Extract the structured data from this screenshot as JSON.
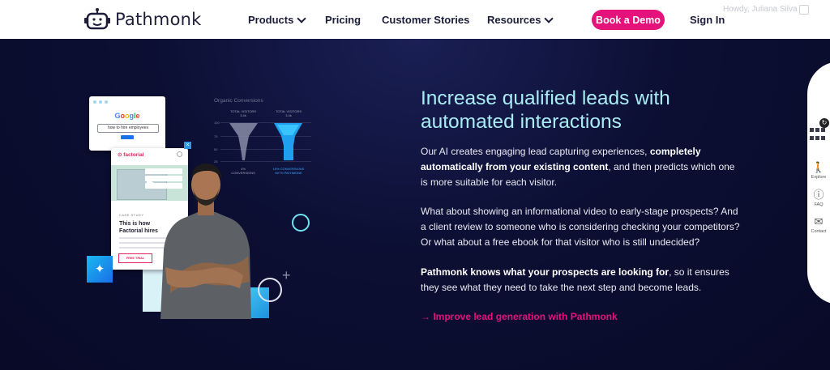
{
  "header": {
    "logo_text": "Pathmonk",
    "nav": [
      {
        "label": "Products",
        "has_dropdown": true
      },
      {
        "label": "Pricing",
        "has_dropdown": false
      },
      {
        "label": "Customer Stories",
        "has_dropdown": false
      },
      {
        "label": "Resources",
        "has_dropdown": true
      }
    ],
    "demo_button": "Book a Demo",
    "sign_in": "Sign In",
    "howdy": "Howdy, Juliana Silva"
  },
  "hero": {
    "headline": "Increase qualified leads with automated interactions",
    "p1_a": "Our AI creates engaging lead capturing experiences, ",
    "p1_b": "completely automatically from your existing content",
    "p1_c": ", and then predicts which one is more suitable for each visitor.",
    "p2": "What about showing an informational video to early-stage prospects? And a client review to someone who is considering checking your competitors? Or what about a free ebook for that visitor who is still undecided?",
    "p3_a": "Pathmonk knows what your prospects are looking for",
    "p3_b": ", so it ensures they see what they need to take the next step and become leads.",
    "cta": "→ Improve lead generation with Pathmonk"
  },
  "illustration": {
    "google_logo": "Google",
    "google_query": "how to hire employees",
    "factorial_logo": "factorial",
    "case_label": "CASE STUDY",
    "case_title": "This is how Factorial hires",
    "free_trial": "FREE TRIAL",
    "close": "×",
    "funnel_title": "Organic Conversions",
    "funnel_hdr_left": "TOTAL VISITORS 3.4k",
    "funnel_hdr_right": "TOTAL VISITORS 3.4k",
    "funnel_rows": [
      "100",
      "75",
      "50",
      "25",
      "0"
    ],
    "funnel_caption_left": "4% CONVERSIONS",
    "funnel_caption_right": "15% CONVERSIONS WITH PATHMONK",
    "sparkle": "✦"
  },
  "sidebar": {
    "badge": "↻",
    "items": [
      {
        "icon": "explore-icon",
        "label": "Explore"
      },
      {
        "icon": "faq-icon",
        "label": "FAQ"
      },
      {
        "icon": "contact-icon",
        "label": "Contact"
      }
    ]
  },
  "colors": {
    "accent": "#e4127a",
    "headline": "#a9ecf5",
    "background": "#0a0c2b"
  }
}
